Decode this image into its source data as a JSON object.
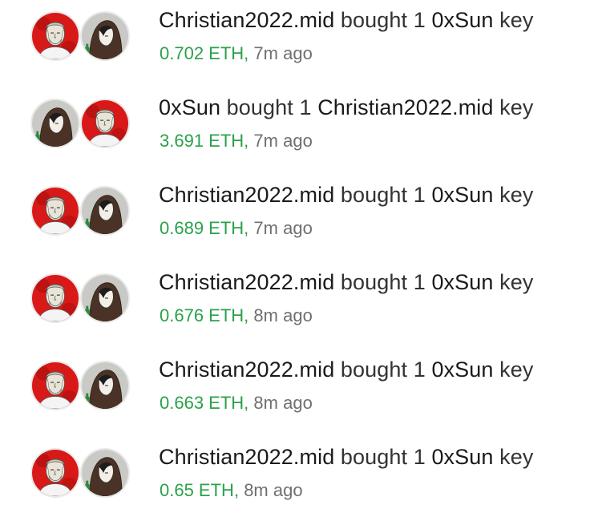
{
  "colors": {
    "eth_green": "#2ba14a",
    "time_gray": "#6f6f6f",
    "text_dark": "#222222"
  },
  "users": {
    "christian": {
      "name": "Christian2022.mid",
      "avatar_icon": "statue-head-red-background-icon"
    },
    "sun": {
      "name": "0xSun",
      "avatar_icon": "hooded-figure-gray-background-icon"
    }
  },
  "trades": [
    {
      "trader": "Christian2022.mid",
      "verb": "bought 1",
      "subject": "0xSun",
      "suffix": "key",
      "price": "0.702 ETH",
      "time": "7m ago",
      "avatars": [
        "christian",
        "sun"
      ]
    },
    {
      "trader": "0xSun",
      "verb": "bought 1",
      "subject": "Christian2022.mid",
      "suffix": "key",
      "price": "3.691 ETH",
      "time": "7m ago",
      "avatars": [
        "sun",
        "christian"
      ]
    },
    {
      "trader": "Christian2022.mid",
      "verb": "bought 1",
      "subject": "0xSun",
      "suffix": "key",
      "price": "0.689 ETH",
      "time": "7m ago",
      "avatars": [
        "christian",
        "sun"
      ]
    },
    {
      "trader": "Christian2022.mid",
      "verb": "bought 1",
      "subject": "0xSun",
      "suffix": "key",
      "price": "0.676 ETH",
      "time": "8m ago",
      "avatars": [
        "christian",
        "sun"
      ]
    },
    {
      "trader": "Christian2022.mid",
      "verb": "bought 1",
      "subject": "0xSun",
      "suffix": "key",
      "price": "0.663 ETH",
      "time": "8m ago",
      "avatars": [
        "christian",
        "sun"
      ]
    },
    {
      "trader": "Christian2022.mid",
      "verb": "bought 1",
      "subject": "0xSun",
      "suffix": "key",
      "price": "0.65 ETH",
      "time": "8m ago",
      "avatars": [
        "christian",
        "sun"
      ]
    }
  ]
}
